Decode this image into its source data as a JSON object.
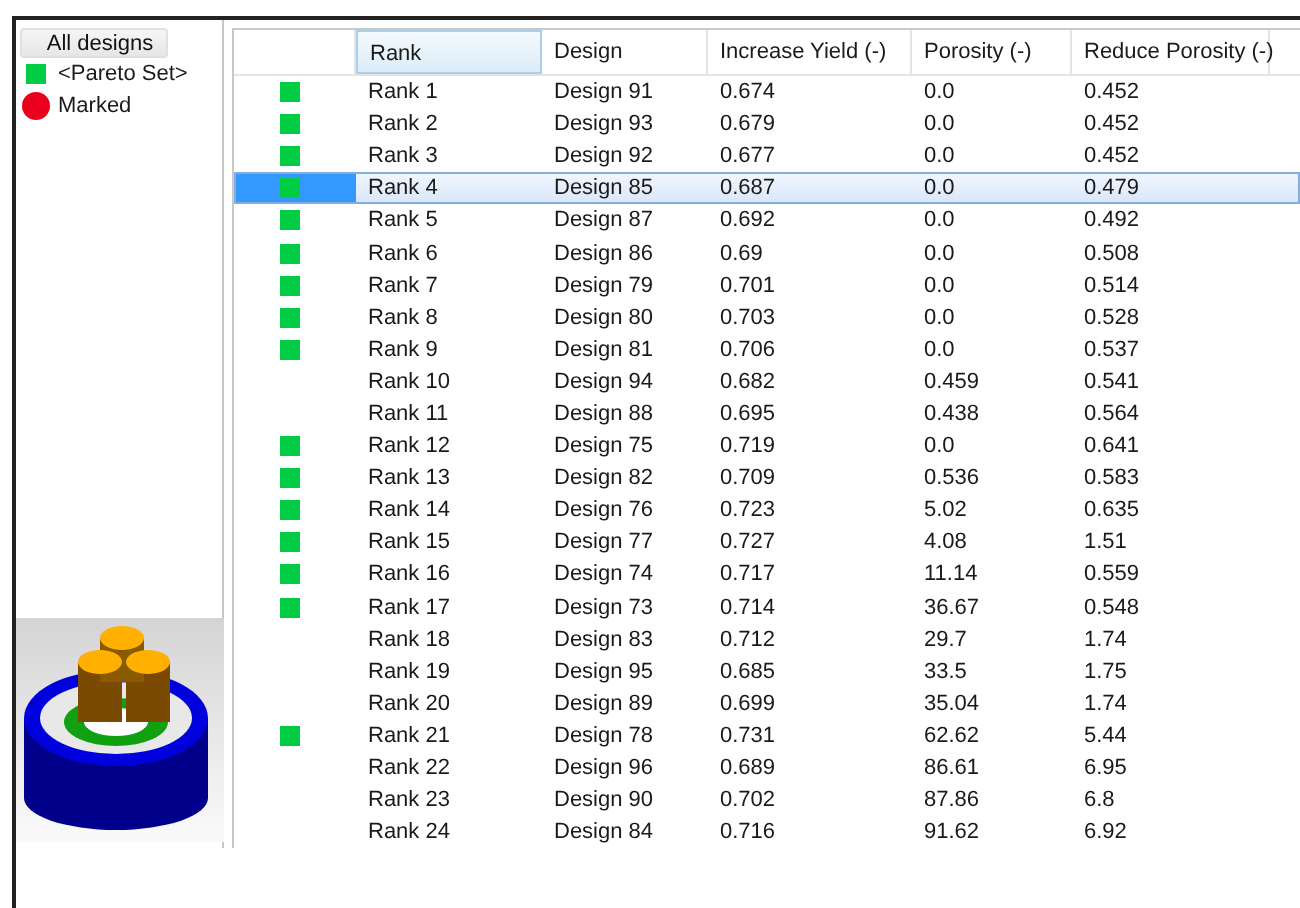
{
  "left_panel": {
    "all_designs_button": "All designs",
    "legend": [
      {
        "kind": "square",
        "label": "<Pareto Set>",
        "color": "#00cc44"
      },
      {
        "kind": "circle",
        "label": "Marked",
        "color": "#e8001c"
      }
    ]
  },
  "table": {
    "columns": [
      "Rank",
      "Design",
      "Increase Yield (-)",
      "Porosity (-)",
      "Reduce Porosity (-)"
    ],
    "rows": [
      {
        "pareto": true,
        "selected": false,
        "cells": [
          "Rank 1",
          "Design 91",
          "0.674",
          "0.0",
          "0.452"
        ]
      },
      {
        "pareto": true,
        "selected": false,
        "cells": [
          "Rank 2",
          "Design 93",
          "0.679",
          "0.0",
          "0.452"
        ]
      },
      {
        "pareto": true,
        "selected": false,
        "cells": [
          "Rank 3",
          "Design 92",
          "0.677",
          "0.0",
          "0.452"
        ]
      },
      {
        "pareto": true,
        "selected": true,
        "cells": [
          "Rank 4",
          "Design 85",
          "0.687",
          "0.0",
          "0.479"
        ]
      },
      {
        "pareto": true,
        "selected": false,
        "cells": [
          "Rank 5",
          "Design 87",
          "0.692",
          "0.0",
          "0.492"
        ]
      },
      {
        "pareto": true,
        "selected": false,
        "cells": [
          "Rank 6",
          "Design 86",
          "0.69",
          "0.0",
          "0.508"
        ]
      },
      {
        "pareto": true,
        "selected": false,
        "cells": [
          "Rank 7",
          "Design 79",
          "0.701",
          "0.0",
          "0.514"
        ]
      },
      {
        "pareto": true,
        "selected": false,
        "cells": [
          "Rank 8",
          "Design 80",
          "0.703",
          "0.0",
          "0.528"
        ]
      },
      {
        "pareto": true,
        "selected": false,
        "cells": [
          "Rank 9",
          "Design 81",
          "0.706",
          "0.0",
          "0.537"
        ]
      },
      {
        "pareto": false,
        "selected": false,
        "cells": [
          "Rank 10",
          "Design 94",
          "0.682",
          "0.459",
          "0.541"
        ]
      },
      {
        "pareto": false,
        "selected": false,
        "cells": [
          "Rank 11",
          "Design 88",
          "0.695",
          "0.438",
          "0.564"
        ]
      },
      {
        "pareto": true,
        "selected": false,
        "cells": [
          "Rank 12",
          "Design 75",
          "0.719",
          "0.0",
          "0.641"
        ]
      },
      {
        "pareto": true,
        "selected": false,
        "cells": [
          "Rank 13",
          "Design 82",
          "0.709",
          "0.536",
          "0.583"
        ]
      },
      {
        "pareto": true,
        "selected": false,
        "cells": [
          "Rank 14",
          "Design 76",
          "0.723",
          "5.02",
          "0.635"
        ]
      },
      {
        "pareto": true,
        "selected": false,
        "cells": [
          "Rank 15",
          "Design 77",
          "0.727",
          "4.08",
          "1.51"
        ]
      },
      {
        "pareto": true,
        "selected": false,
        "cells": [
          "Rank 16",
          "Design 74",
          "0.717",
          "11.14",
          "0.559"
        ]
      },
      {
        "pareto": true,
        "selected": false,
        "cells": [
          "Rank 17",
          "Design 73",
          "0.714",
          "36.67",
          "0.548"
        ]
      },
      {
        "pareto": false,
        "selected": false,
        "cells": [
          "Rank 18",
          "Design 83",
          "0.712",
          "29.7",
          "1.74"
        ]
      },
      {
        "pareto": false,
        "selected": false,
        "cells": [
          "Rank 19",
          "Design 95",
          "0.685",
          "33.5",
          "1.75"
        ]
      },
      {
        "pareto": false,
        "selected": false,
        "cells": [
          "Rank 20",
          "Design 89",
          "0.699",
          "35.04",
          "1.74"
        ]
      },
      {
        "pareto": true,
        "selected": false,
        "cells": [
          "Rank 21",
          "Design 78",
          "0.731",
          "62.62",
          "5.44"
        ]
      },
      {
        "pareto": false,
        "selected": false,
        "cells": [
          "Rank 22",
          "Design 96",
          "0.689",
          "86.61",
          "6.95"
        ]
      },
      {
        "pareto": false,
        "selected": false,
        "cells": [
          "Rank 23",
          "Design 90",
          "0.702",
          "87.86",
          "6.8"
        ]
      },
      {
        "pareto": false,
        "selected": false,
        "cells": [
          "Rank 24",
          "Design 84",
          "0.716",
          "91.62",
          "6.92"
        ]
      }
    ]
  }
}
